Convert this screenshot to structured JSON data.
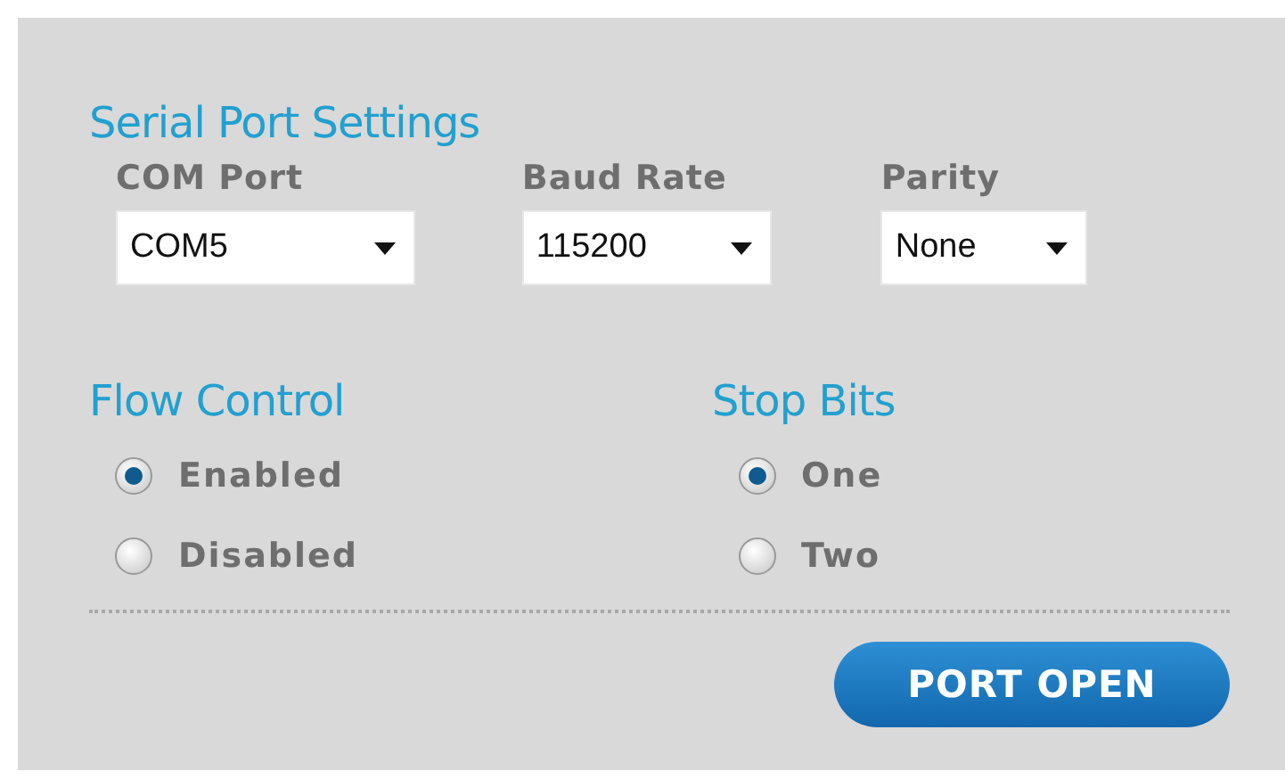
{
  "title": "Serial Port Settings",
  "selects": [
    {
      "label": "COM Port",
      "value": "COM5"
    },
    {
      "label": "Baud Rate",
      "value": "115200"
    },
    {
      "label": "Parity",
      "value": "None"
    }
  ],
  "radio_groups": [
    {
      "title": "Flow Control",
      "options": [
        {
          "label": "Enabled",
          "selected": true
        },
        {
          "label": "Disabled",
          "selected": false
        }
      ]
    },
    {
      "title": "Stop Bits",
      "options": [
        {
          "label": "One",
          "selected": true
        },
        {
          "label": "Two",
          "selected": false
        }
      ]
    }
  ],
  "button": "PORT OPEN"
}
